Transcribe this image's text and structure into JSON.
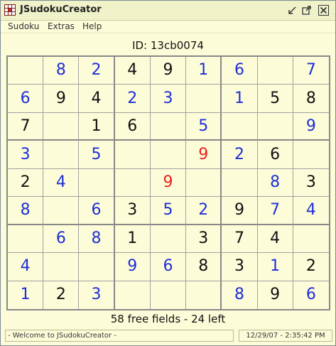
{
  "window": {
    "title": "JSudokuCreator",
    "icons": [
      "app-grid-icon",
      "minimize-icon",
      "maximize-icon",
      "close-icon"
    ]
  },
  "menu": {
    "items": [
      "Sudoku",
      "Extras",
      "Help"
    ]
  },
  "puzzle": {
    "id_label": "ID: 13cb0074",
    "status": "58 free fields - 24 left",
    "colors": {
      "given": "#111111",
      "entered": "#1f2fd6",
      "conflict": "#e8231e",
      "background": "#fdfcd9"
    },
    "rows": [
      [
        {
          "v": "",
          "t": ""
        },
        {
          "v": "8",
          "t": "entered"
        },
        {
          "v": "2",
          "t": "entered"
        },
        {
          "v": "4",
          "t": "given"
        },
        {
          "v": "9",
          "t": "given"
        },
        {
          "v": "1",
          "t": "entered"
        },
        {
          "v": "6",
          "t": "entered"
        },
        {
          "v": "",
          "t": ""
        },
        {
          "v": "7",
          "t": "entered"
        }
      ],
      [
        {
          "v": "6",
          "t": "entered"
        },
        {
          "v": "9",
          "t": "given"
        },
        {
          "v": "4",
          "t": "given"
        },
        {
          "v": "2",
          "t": "entered"
        },
        {
          "v": "3",
          "t": "entered"
        },
        {
          "v": "",
          "t": ""
        },
        {
          "v": "1",
          "t": "entered"
        },
        {
          "v": "5",
          "t": "given"
        },
        {
          "v": "8",
          "t": "given"
        }
      ],
      [
        {
          "v": "7",
          "t": "given"
        },
        {
          "v": "",
          "t": ""
        },
        {
          "v": "1",
          "t": "given"
        },
        {
          "v": "6",
          "t": "given"
        },
        {
          "v": "",
          "t": ""
        },
        {
          "v": "5",
          "t": "entered"
        },
        {
          "v": "",
          "t": ""
        },
        {
          "v": "",
          "t": ""
        },
        {
          "v": "9",
          "t": "entered"
        }
      ],
      [
        {
          "v": "3",
          "t": "entered"
        },
        {
          "v": "",
          "t": ""
        },
        {
          "v": "5",
          "t": "entered"
        },
        {
          "v": "",
          "t": ""
        },
        {
          "v": "",
          "t": ""
        },
        {
          "v": "9",
          "t": "conflict"
        },
        {
          "v": "2",
          "t": "entered"
        },
        {
          "v": "6",
          "t": "given"
        },
        {
          "v": "",
          "t": ""
        }
      ],
      [
        {
          "v": "2",
          "t": "given"
        },
        {
          "v": "4",
          "t": "entered"
        },
        {
          "v": "",
          "t": ""
        },
        {
          "v": "",
          "t": ""
        },
        {
          "v": "9",
          "t": "conflict"
        },
        {
          "v": "",
          "t": ""
        },
        {
          "v": "",
          "t": ""
        },
        {
          "v": "8",
          "t": "entered"
        },
        {
          "v": "3",
          "t": "given"
        }
      ],
      [
        {
          "v": "8",
          "t": "entered"
        },
        {
          "v": "",
          "t": ""
        },
        {
          "v": "6",
          "t": "entered"
        },
        {
          "v": "3",
          "t": "given"
        },
        {
          "v": "5",
          "t": "entered"
        },
        {
          "v": "2",
          "t": "entered"
        },
        {
          "v": "9",
          "t": "given"
        },
        {
          "v": "7",
          "t": "entered"
        },
        {
          "v": "4",
          "t": "entered"
        }
      ],
      [
        {
          "v": "",
          "t": ""
        },
        {
          "v": "6",
          "t": "entered"
        },
        {
          "v": "8",
          "t": "entered"
        },
        {
          "v": "1",
          "t": "given"
        },
        {
          "v": "",
          "t": ""
        },
        {
          "v": "3",
          "t": "given"
        },
        {
          "v": "7",
          "t": "given"
        },
        {
          "v": "4",
          "t": "given"
        },
        {
          "v": "",
          "t": ""
        }
      ],
      [
        {
          "v": "4",
          "t": "entered"
        },
        {
          "v": "",
          "t": ""
        },
        {
          "v": "",
          "t": ""
        },
        {
          "v": "9",
          "t": "entered"
        },
        {
          "v": "6",
          "t": "entered"
        },
        {
          "v": "8",
          "t": "given"
        },
        {
          "v": "3",
          "t": "given"
        },
        {
          "v": "1",
          "t": "entered"
        },
        {
          "v": "2",
          "t": "given"
        }
      ],
      [
        {
          "v": "1",
          "t": "entered"
        },
        {
          "v": "2",
          "t": "given"
        },
        {
          "v": "3",
          "t": "entered"
        },
        {
          "v": "",
          "t": ""
        },
        {
          "v": "",
          "t": ""
        },
        {
          "v": "",
          "t": ""
        },
        {
          "v": "8",
          "t": "entered"
        },
        {
          "v": "9",
          "t": "given"
        },
        {
          "v": "6",
          "t": "entered"
        }
      ]
    ]
  },
  "statusbar": {
    "message": "- Welcome to JSudokuCreator -",
    "datetime": "12/29/07 - 2:35:42 PM"
  }
}
